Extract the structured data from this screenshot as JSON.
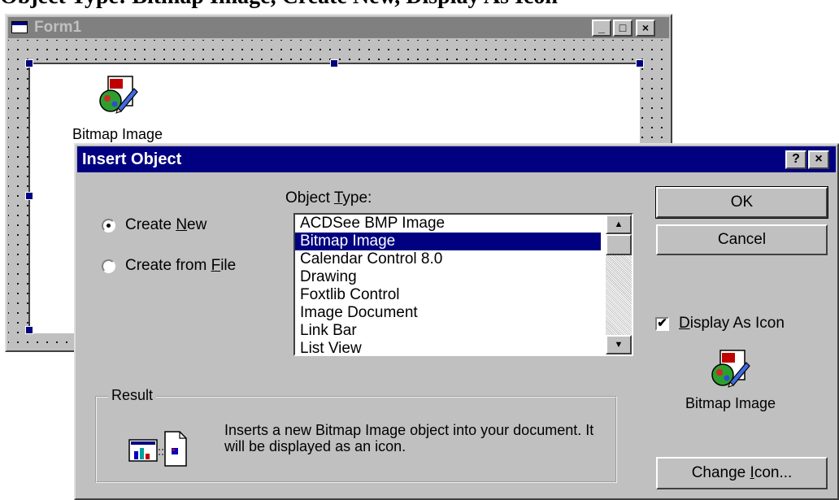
{
  "clip_text": "Object Type: Bitmap Image, Create New, Display As Icon",
  "form": {
    "title": "Form1",
    "object_label": "Bitmap Image",
    "buttons": {
      "minimize": "_",
      "maximize": "□",
      "close": "×"
    }
  },
  "dialog": {
    "title": "Insert Object",
    "help_button": "?",
    "close_button": "×",
    "create_new": {
      "pre": "Create ",
      "key": "N",
      "post": "ew"
    },
    "create_from_file": {
      "pre": "Create from ",
      "key": "F",
      "post": "ile"
    },
    "object_type_label": {
      "pre": "Object ",
      "key": "T",
      "post": "ype:"
    },
    "object_types": [
      "ACDSee BMP Image",
      "Bitmap Image",
      "Calendar Control 8.0",
      "Drawing",
      "Foxtlib Control",
      "Image Document",
      "Link Bar",
      "List View"
    ],
    "selected_index": 1,
    "ok_label": "OK",
    "cancel_label": "Cancel",
    "display_as_icon": {
      "key": "D",
      "post": "isplay As Icon",
      "checked": true
    },
    "icon_label": "Bitmap Image",
    "change_icon": {
      "pre": "Change ",
      "key": "I",
      "post": "con..."
    },
    "result": {
      "legend": "Result",
      "text": "Inserts a new Bitmap Image object into your document.  It will be displayed as an icon."
    }
  },
  "colors": {
    "title_active": "#000080",
    "title_inactive": "#808080",
    "face": "#c0c0c0",
    "selection": "#000080"
  }
}
